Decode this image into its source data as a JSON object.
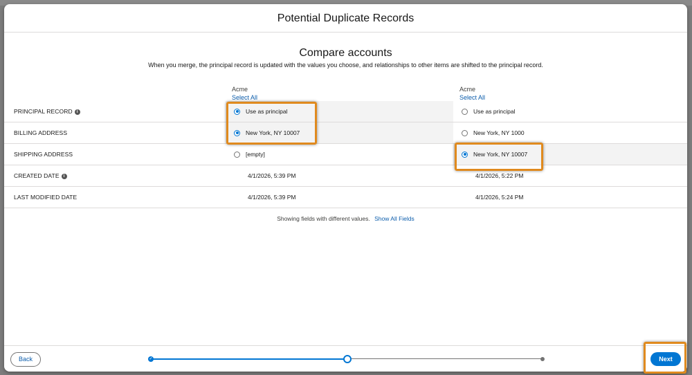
{
  "modal": {
    "title": "Potential Duplicate Records"
  },
  "compare": {
    "title": "Compare accounts",
    "subtitle": "When you merge, the principal record is updated with the values you choose, and relationships to other items are shifted to the principal record."
  },
  "columns": [
    {
      "name": "Acme",
      "select_all": "Select All"
    },
    {
      "name": "Acme",
      "select_all": "Select All"
    }
  ],
  "rows": [
    {
      "label": "PRINCIPAL RECORD",
      "values": [
        "Use as principal",
        "Use as principal"
      ]
    },
    {
      "label": "BILLING ADDRESS",
      "values": [
        "New York, NY 10007",
        "New York, NY 1000"
      ]
    },
    {
      "label": "SHIPPING ADDRESS",
      "values": [
        "[empty]",
        "New York, NY 10007"
      ]
    },
    {
      "label": "CREATED DATE",
      "values": [
        "4/1/2026, 5:39 PM",
        "4/1/2026, 5:22 PM"
      ]
    },
    {
      "label": "LAST MODIFIED DATE",
      "values": [
        "4/1/2026, 5:39 PM",
        "4/1/2026, 5:24 PM"
      ]
    }
  ],
  "footnote": {
    "text": "Showing fields with different values.",
    "link": "Show All Fields"
  },
  "footer": {
    "back_label": "Back",
    "next_label": "Next"
  },
  "colors": {
    "brand": "#0176d3",
    "highlight": "#e08a1e"
  }
}
